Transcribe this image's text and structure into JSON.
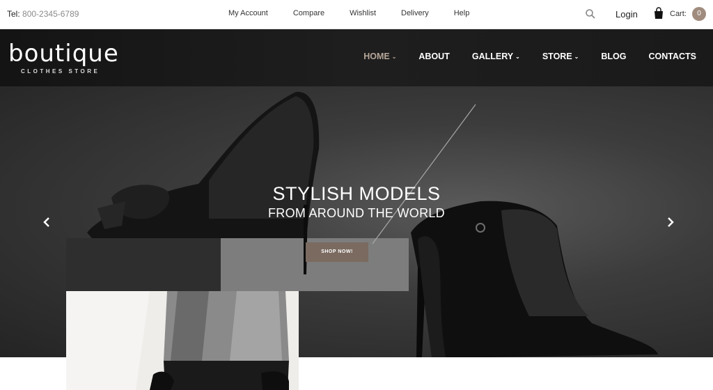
{
  "topbar": {
    "tel_label": "Tel:",
    "tel_number": "800-2345-6789",
    "links": [
      "My Account",
      "Compare",
      "Wishlist",
      "Delivery",
      "Help"
    ],
    "login": "Login",
    "cart_label": "Cart:",
    "cart_count": "0",
    "icons": {
      "search": "search-icon",
      "cart": "shopping-bag-icon"
    }
  },
  "header": {
    "logo_text": "boutique",
    "logo_tagline": "CLOTHES STORE",
    "nav": [
      {
        "label": "HOME",
        "chevron": "⌄",
        "active": true
      },
      {
        "label": "ABOUT",
        "chevron": "",
        "active": false
      },
      {
        "label": "GALLERY",
        "chevron": "⌄",
        "active": false
      },
      {
        "label": "STORE",
        "chevron": "⌄",
        "active": false
      },
      {
        "label": "BLOG",
        "chevron": "",
        "active": false
      },
      {
        "label": "CONTACTS",
        "chevron": "",
        "active": false
      }
    ]
  },
  "hero": {
    "title": "STYLISH MODELS",
    "subtitle": "FROM AROUND THE WORLD",
    "cta": "SHOP NOW!",
    "prev_icon": "chevron-left-icon",
    "next_icon": "chevron-right-icon"
  },
  "colors": {
    "accent": "#b7a79a",
    "button": "#7a6a60",
    "header_bg": "#1a1a1a",
    "cart_badge": "#a08c7e"
  }
}
